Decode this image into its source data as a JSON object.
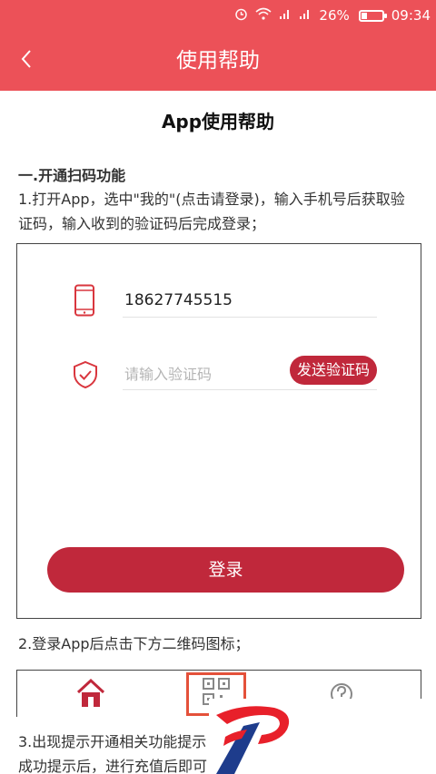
{
  "status_bar": {
    "alarm_icon": "alarm-clock-icon",
    "wifi_icon": "wifi-icon",
    "signal_icons": [
      "signal-icon",
      "signal-icon"
    ],
    "battery_text": "26%",
    "battery_level": 0.26,
    "time": "09:34"
  },
  "nav": {
    "back_icon": "chevron-left-icon",
    "title": "使用帮助"
  },
  "doc": {
    "title": "App使用帮助",
    "section1_heading": "一.开通扫码功能",
    "step1": "1.打开App，选中\"我的\"(点击请登录)，输入手机号后获取验证码，输入收到的验证码后完成登录；",
    "step2": "2.登录App后点击下方二维码图标；",
    "step3": "3.出现提示开通相关功能提示成功提示后，进行充值后即可"
  },
  "login_form": {
    "phone_icon": "mobile-phone-icon",
    "phone_value": "18627745515",
    "shield_icon": "shield-check-icon",
    "code_placeholder": "请输入验证码",
    "send_code_label": "发送验证码",
    "login_label": "登录"
  },
  "tab_bar": {
    "home_icon": "home-icon",
    "qr_icon": "qr-code-icon",
    "help_icon": "help-circle-icon",
    "qr_highlight_color": "#e4513a"
  },
  "colors": {
    "header": "#ec5158",
    "button": "#c0283b"
  },
  "logo": {
    "name": "brand-logo"
  }
}
